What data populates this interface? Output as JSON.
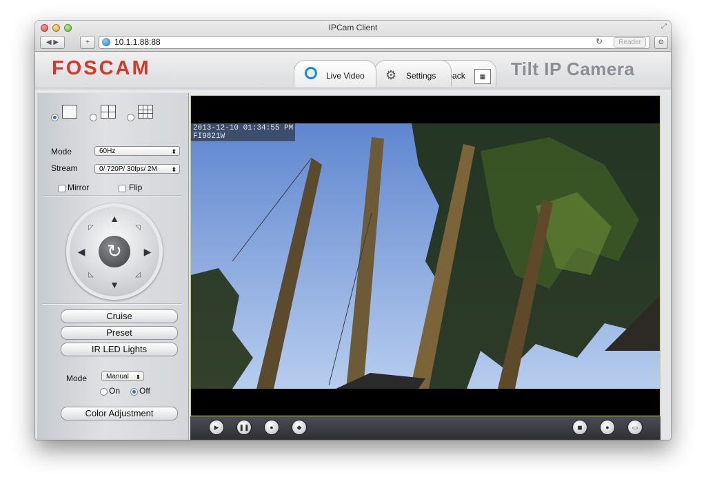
{
  "window": {
    "title": "IPCam Client",
    "url": "10.1.1.88:88",
    "reader_label": "Reader"
  },
  "header": {
    "logo": "FOSCAM",
    "camera_title": "Tilt IP Camera",
    "tabs": [
      {
        "label": "Live Video",
        "icon": "webcam-icon",
        "active": true
      },
      {
        "label": "Settings",
        "icon": "gears-icon",
        "active": false
      },
      {
        "label": "Playback",
        "icon": "calendar-icon",
        "active": false
      }
    ]
  },
  "left": {
    "layouts": [
      "single-view",
      "quad-view",
      "nine-view"
    ],
    "mode_label": "Mode",
    "mode_value": "60Hz",
    "stream_label": "Stream",
    "stream_value": "0/ 720P/ 30fps/ 2M",
    "mirror_label": "Mirror",
    "flip_label": "Flip",
    "buttons": {
      "cruise": "Cruise",
      "preset": "Preset",
      "ir_led": "IR LED Lights",
      "color_adjustment": "Color Adjustment"
    },
    "ir_mode_label": "Mode",
    "ir_mode_value": "Manual",
    "on_label": "On",
    "off_label": "Off",
    "ir_state": "Off"
  },
  "video": {
    "osd_timestamp": "2013-12-10 01:34:55 PM",
    "osd_camera_id": "FI9821W"
  },
  "colors": {
    "logo_red": "#d13a2c",
    "video_border": "#d6cf4f",
    "sky": "#7aa3e0"
  }
}
